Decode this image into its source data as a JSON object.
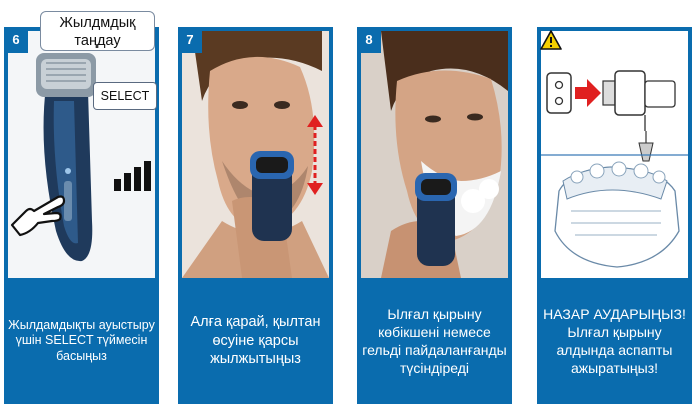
{
  "callout": {
    "text": "Жылдмдық таңдау"
  },
  "select_label": "SELECT",
  "panels": [
    {
      "number": "6",
      "caption": "Жылдамдықты ауыстыру үшін SELECT түймесін басыңыз"
    },
    {
      "number": "7",
      "caption": "Алға қарай, қылтан өсуіне қарсы жылжытыңыз"
    },
    {
      "number": "8",
      "caption": "Ылғал қырыну көбікшені немесе гельді пайдаланғанды түсіндіреді"
    },
    {
      "number": "",
      "caption": "НАЗАР АУДАРЫҢЫЗ! Ылғал қырыну алдында аспапты ажыратыңыз!"
    }
  ],
  "colors": {
    "panel": "#0a6cae",
    "warning": "#f5d000",
    "arrow": "#e02020"
  },
  "icons": [
    "hand-pointer-icon",
    "speed-bars-icon",
    "warning-icon",
    "plug-arrow-icon"
  ]
}
